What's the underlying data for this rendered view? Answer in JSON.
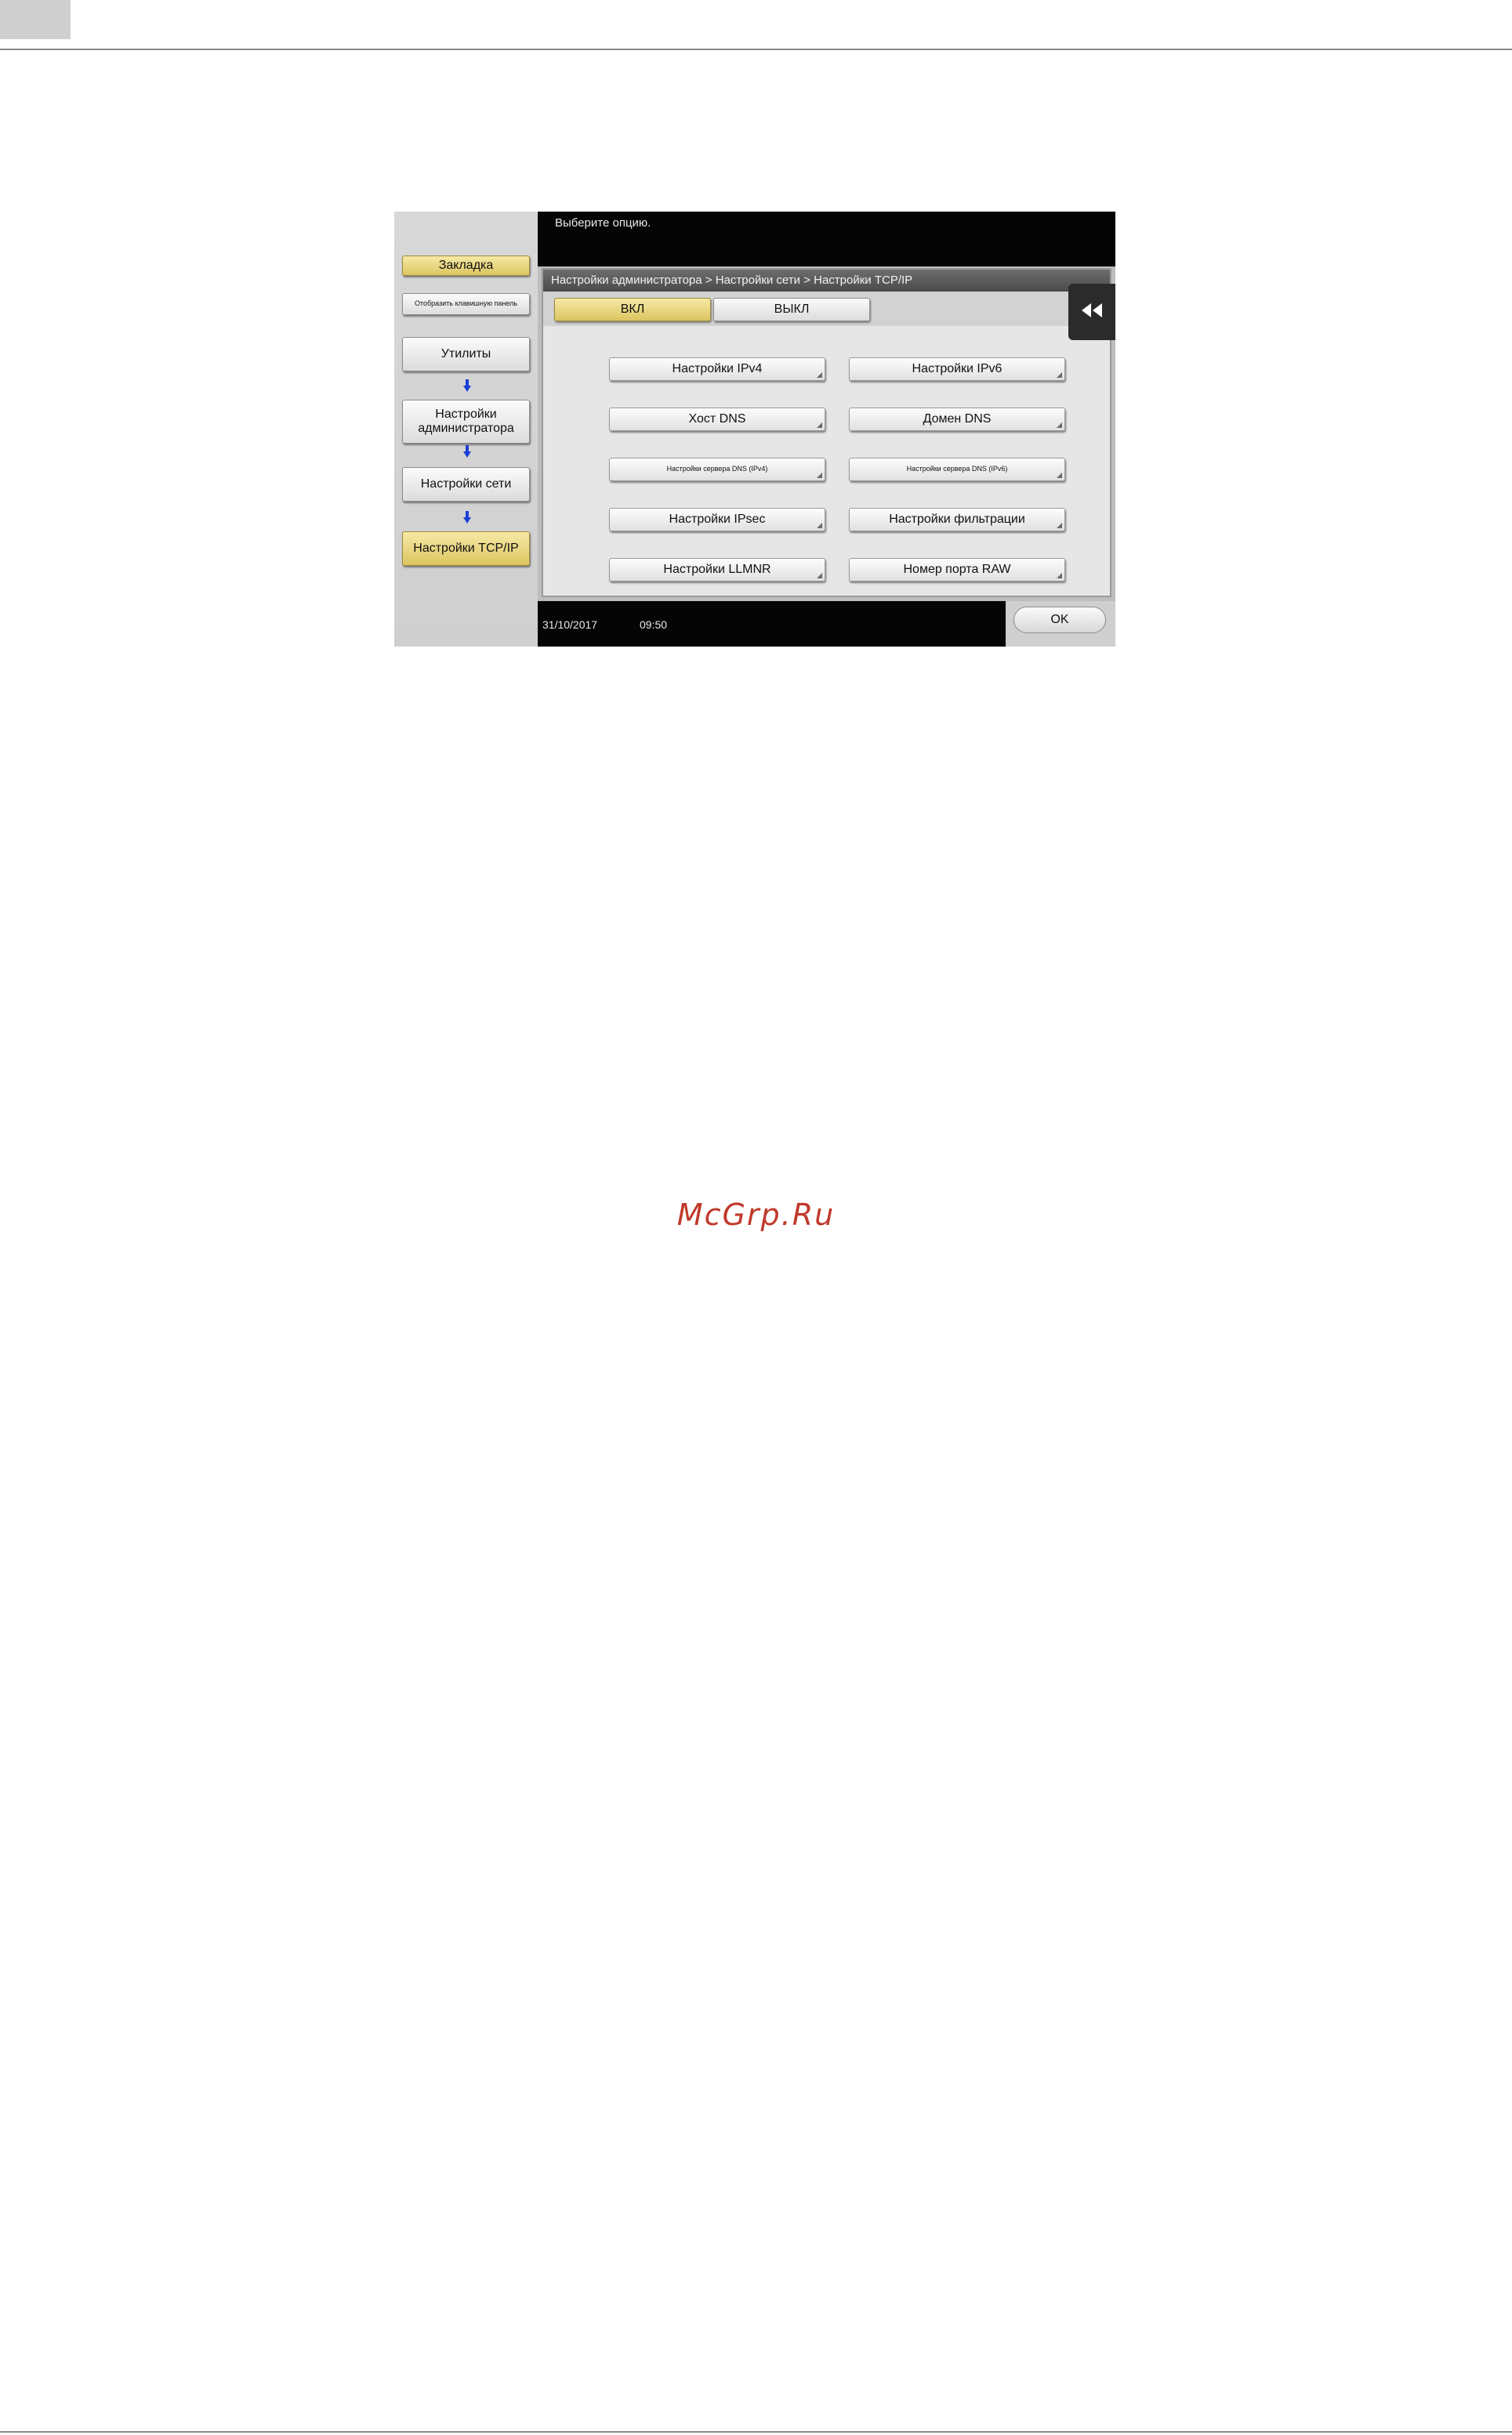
{
  "watermark": "McGrp.Ru",
  "screen": {
    "header_message": "Выберите опцию.",
    "breadcrumb": "Настройки администратора > Настройки сети > Настройки TCP/IP",
    "sidebar": {
      "bookmark_label": "Закладка",
      "keypad_label": "Отобразить клавишную панель",
      "steps": [
        "Утилиты",
        "Настройки администратора",
        "Настройки сети",
        "Настройки TCP/IP"
      ]
    },
    "toggle": {
      "on_label": "ВКЛ",
      "off_label": "ВЫКЛ",
      "selected": "ВКЛ"
    },
    "options": [
      "Настройки IPv4",
      "Настройки IPv6",
      "Хост DNS",
      "Домен DNS",
      "Настройки сервера DNS (IPv4)",
      "Настройки сервера DNS (IPv6)",
      "Настройки IPsec",
      "Настройки фильтрации",
      "Настройки LLMNR",
      "Номер порта RAW"
    ],
    "back_icon": "double-chevron-left-icon",
    "date": "31/10/2017",
    "time": "09:50",
    "ok_label": "OK"
  },
  "colors": {
    "accent_gold": "#dcc560",
    "watermark": "#c0392b",
    "bar_black": "#050505"
  }
}
